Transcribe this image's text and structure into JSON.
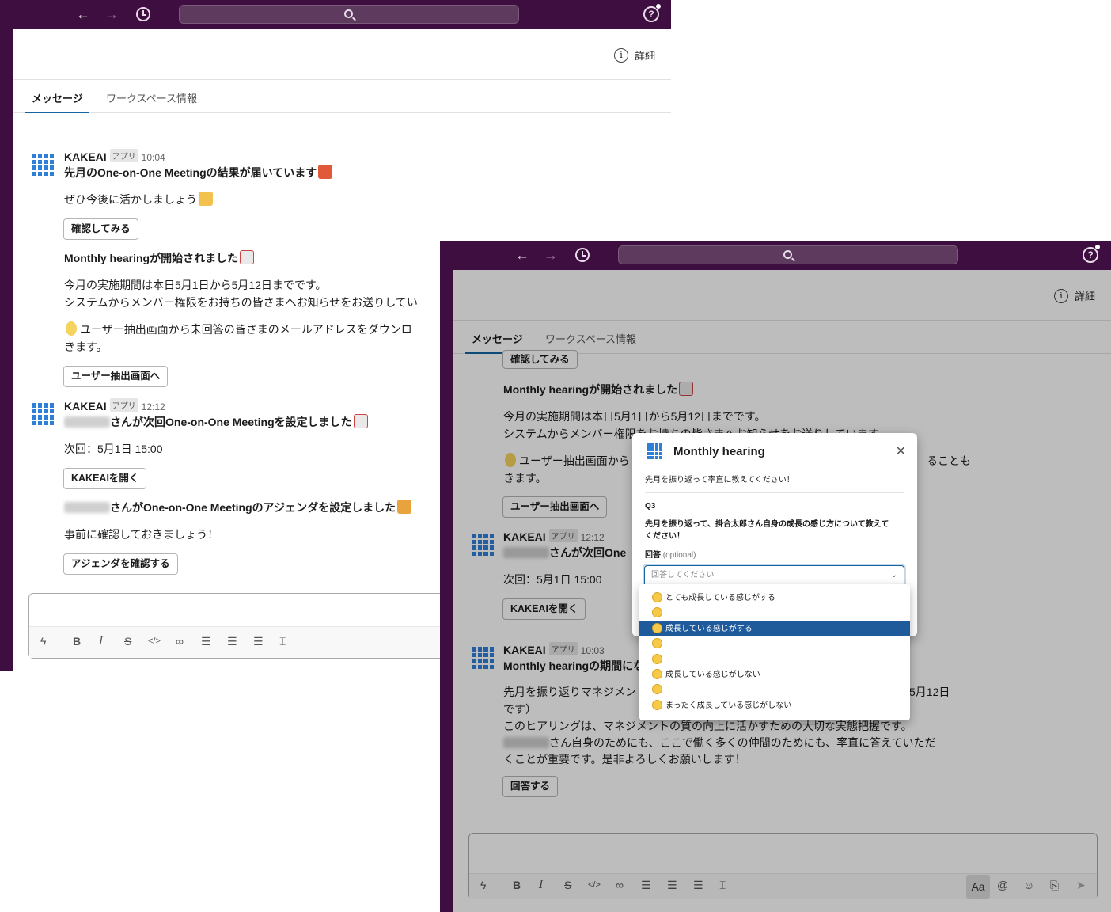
{
  "window1": {
    "header": {
      "detail_label": "詳細"
    },
    "tabs": [
      {
        "label": "メッセージ"
      },
      {
        "label": "ワークスペース情報"
      }
    ],
    "messages": [
      {
        "sender": "KAKEAI",
        "badge": "アプリ",
        "time": "10:04",
        "title": "先月のOne-on-One Meetingの結果が届いています",
        "line1": "ぜひ今後に活かしましょう",
        "button": "確認してみる",
        "subtitle": "Monthly hearingが開始されました",
        "body1": "今月の実施期間は本日5月1日から5月12日までです。",
        "body2": "システムからメンバー権限をお持ちの皆さまへお知らせをお送りしてい",
        "body3": "ユーザー抽出画面から未回答の皆さまのメールアドレスをダウンロ",
        "body4": "きます。",
        "button2": "ユーザー抽出画面へ"
      },
      {
        "sender": "KAKEAI",
        "badge": "アプリ",
        "time": "12:12",
        "title_suffix": "さんが次回One-on-One Meetingを設定しました",
        "next": "次回：5月1日 15:00",
        "button": "KAKEAIを開く",
        "agenda_suffix": "さんがOne-on-One Meetingのアジェンダを設定しました",
        "agenda_line": "事前に確認しておきましょう！",
        "button2": "アジェンダを確認する"
      }
    ]
  },
  "window2": {
    "header": {
      "detail_label": "詳細"
    },
    "tabs": [
      {
        "label": "メッセージ"
      },
      {
        "label": "ワークスペース情報"
      }
    ],
    "bg": {
      "button_top": "確認してみる",
      "subtitle": "Monthly hearingが開始されました",
      "body1": "今月の実施期間は本日5月1日から5月12日までです。",
      "body2": "システムからメンバー権限をお持ちの皆さまへお知らせをお送りしています。",
      "body3a": "ユーザー抽出画面から",
      "body3b": "ることも",
      "body4": "きます。",
      "button2": "ユーザー抽出画面へ",
      "sender": "KAKEAI",
      "badge": "アプリ",
      "time2": "12:12",
      "title2": "さんが次回One",
      "next": "次回：5月1日 15:00",
      "button3": "KAKEAIを開く",
      "time3": "10:03",
      "title3": "Monthly hearingの期間にな",
      "p1a": "先月を振り返りマネジメン",
      "p1b": "5月12日",
      "p2": "です）",
      "p3": "このヒアリングは、マネジメントの質の向上に活かすための大切な実態把握です。",
      "p4": "さん自身のためにも、ここで働く多くの仲間のためにも、率直に答えていただ",
      "p5": "くことが重要です。是非よろしくお願いします！",
      "button4": "回答する"
    },
    "modal": {
      "title": "Monthly hearing",
      "intro": "先月を振り返って率直に教えてください！",
      "q_label": "Q3",
      "question_l1": "先月を振り返って、掛合太郎さん自身の成長の感じ方について教えて",
      "question_l2": "ください！",
      "answer_label": "回答",
      "optional": "(optional)",
      "placeholder": "回答してください"
    },
    "dropdown": [
      {
        "label": "とても成長している感じがする",
        "selected": false
      },
      {
        "label": "",
        "selected": false
      },
      {
        "label": "成長している感じがする",
        "selected": true
      },
      {
        "label": "",
        "selected": false
      },
      {
        "label": "",
        "selected": false
      },
      {
        "label": "成長している感じがしない",
        "selected": false
      },
      {
        "label": "",
        "selected": false
      },
      {
        "label": "まったく成長している感じがしない",
        "selected": false
      }
    ],
    "composer": {
      "format_label": "Aa"
    }
  }
}
